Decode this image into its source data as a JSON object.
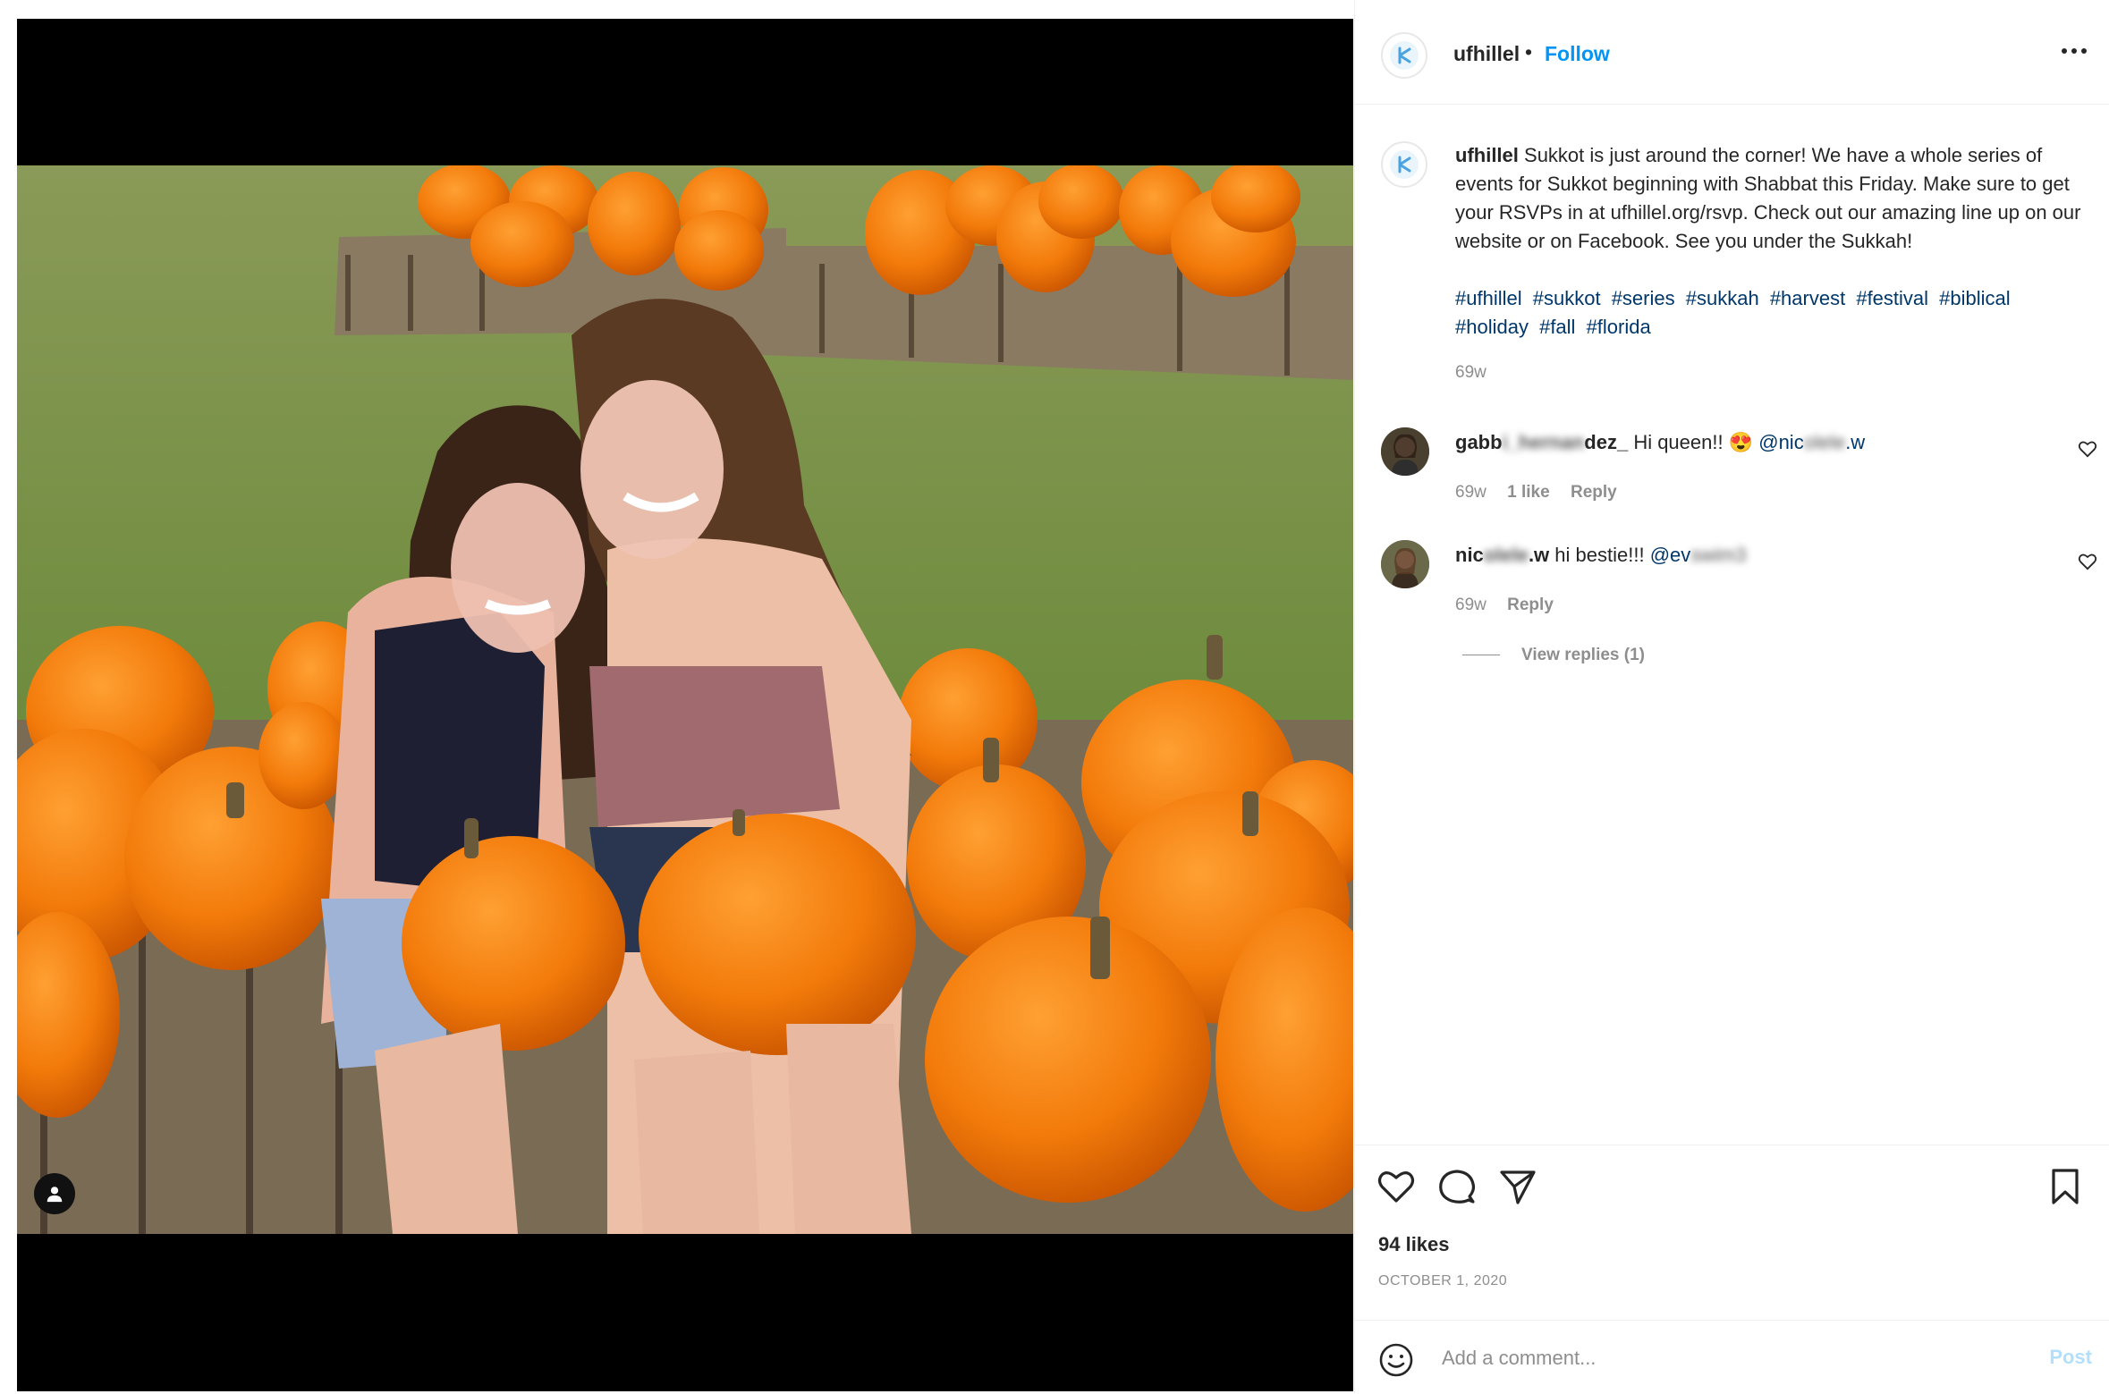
{
  "post": {
    "username": "ufhillel",
    "follow_label": "Follow",
    "dot": "•",
    "more_label": "More options"
  },
  "caption": {
    "username": "ufhillel",
    "text": "Sukkot is just around the corner! We have a whole series of events for Sukkot beginning with Shabbat this Friday. Make sure to get your RSVPs in at ufhillel.org/rsvp. Check out our amazing line up on our website or on Facebook. See you under the Sukkah!",
    "hashtags": [
      "#ufhillel",
      "#sukkot",
      "#series",
      "#sukkah",
      "#harvest",
      "#festival",
      "#biblical",
      "#holiday",
      "#fall",
      "#florida"
    ],
    "time": "69w"
  },
  "comments": [
    {
      "user_start": "gabb",
      "user_blur": "i_hernan",
      "user_end": "dez_",
      "text": "Hi queen!! 😍",
      "mention_start": "@nic",
      "mention_blur": "olele",
      "mention_end": ".w",
      "time": "69w",
      "likes": "1 like",
      "reply_label": "Reply"
    },
    {
      "user_start": "nic",
      "user_blur": "olele",
      "user_end": ".w",
      "text": "hi bestie!!!",
      "mention_start": "@ev",
      "mention_blur": "swim3",
      "mention_end": "",
      "time": "69w",
      "reply_label": "Reply"
    }
  ],
  "view_replies": "View replies (1)",
  "likes": "94 likes",
  "date": "OCTOBER 1, 2020",
  "add_comment": {
    "placeholder": "Add a comment...",
    "post_label": "Post"
  },
  "colors": {
    "accent": "#0095f6",
    "hashtag": "#00376b",
    "muted": "#8e8e8e",
    "post_disabled": "#b2dffc"
  },
  "icons": {
    "like": "heart-icon",
    "comment": "comment-bubble-icon",
    "share": "paper-plane-icon",
    "save": "bookmark-icon",
    "emoji": "smiley-icon",
    "more": "ellipsis-icon",
    "tagged_users": "person-icon"
  }
}
